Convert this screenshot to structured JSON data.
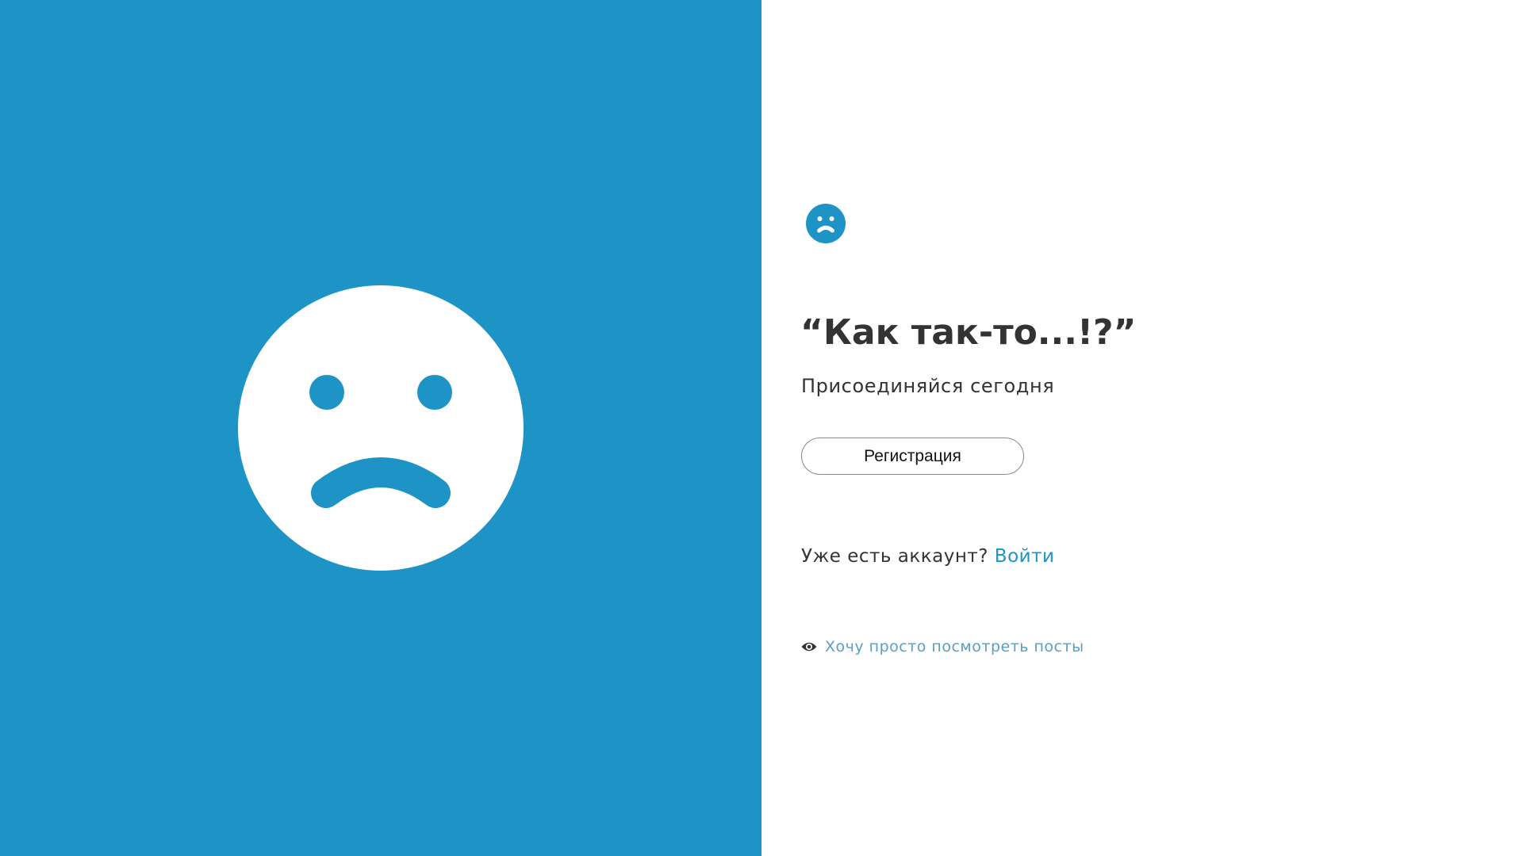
{
  "colors": {
    "brand": "#1d94c5",
    "text": "#333333",
    "guest_link": "#5a9ec0",
    "background": "#ffffff"
  },
  "icons": {
    "hero": "sad-face-icon",
    "logo": "sad-face-logo-icon",
    "guest": "eye-icon"
  },
  "auth": {
    "headline": "“Как так-то...!?”",
    "subtitle": "Присоединяйся сегодня",
    "register_label": "Регистрация",
    "login_prompt": "Уже есть аккаунт?",
    "login_label": "Войти",
    "guest_label": "Хочу просто посмотреть посты"
  }
}
